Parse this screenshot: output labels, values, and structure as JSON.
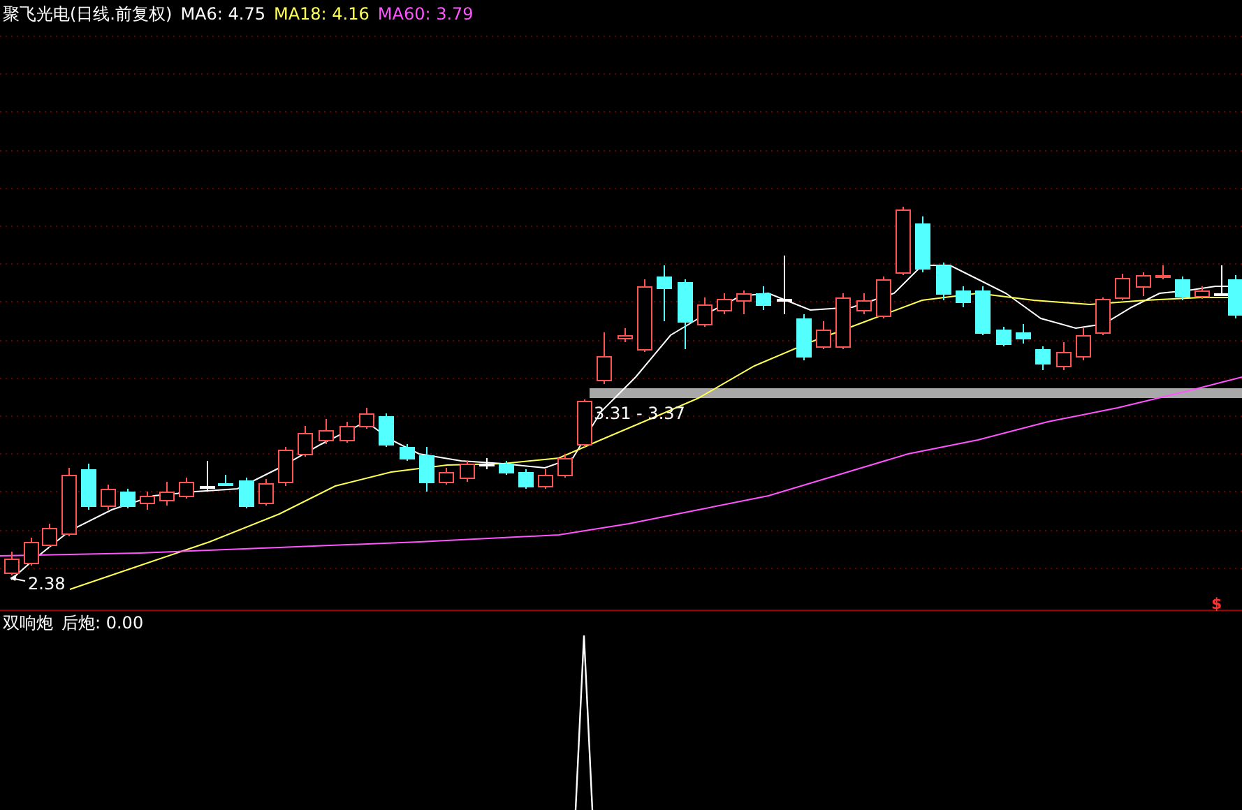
{
  "chart": {
    "title": "聚飞光电(日线.前复权)",
    "legend": [
      {
        "label": "MA6: 4.75",
        "color": "#ffffff"
      },
      {
        "label": "MA18: 4.16",
        "color": "#ffff54"
      },
      {
        "label": "MA60: 3.79",
        "color": "#ff54ff"
      }
    ],
    "range_label": "3.31 - 3.37",
    "low_label": "2.38",
    "signal_marker": "$"
  },
  "indicator": {
    "name": "双响炮",
    "reading": "后炮: 0.00"
  }
}
